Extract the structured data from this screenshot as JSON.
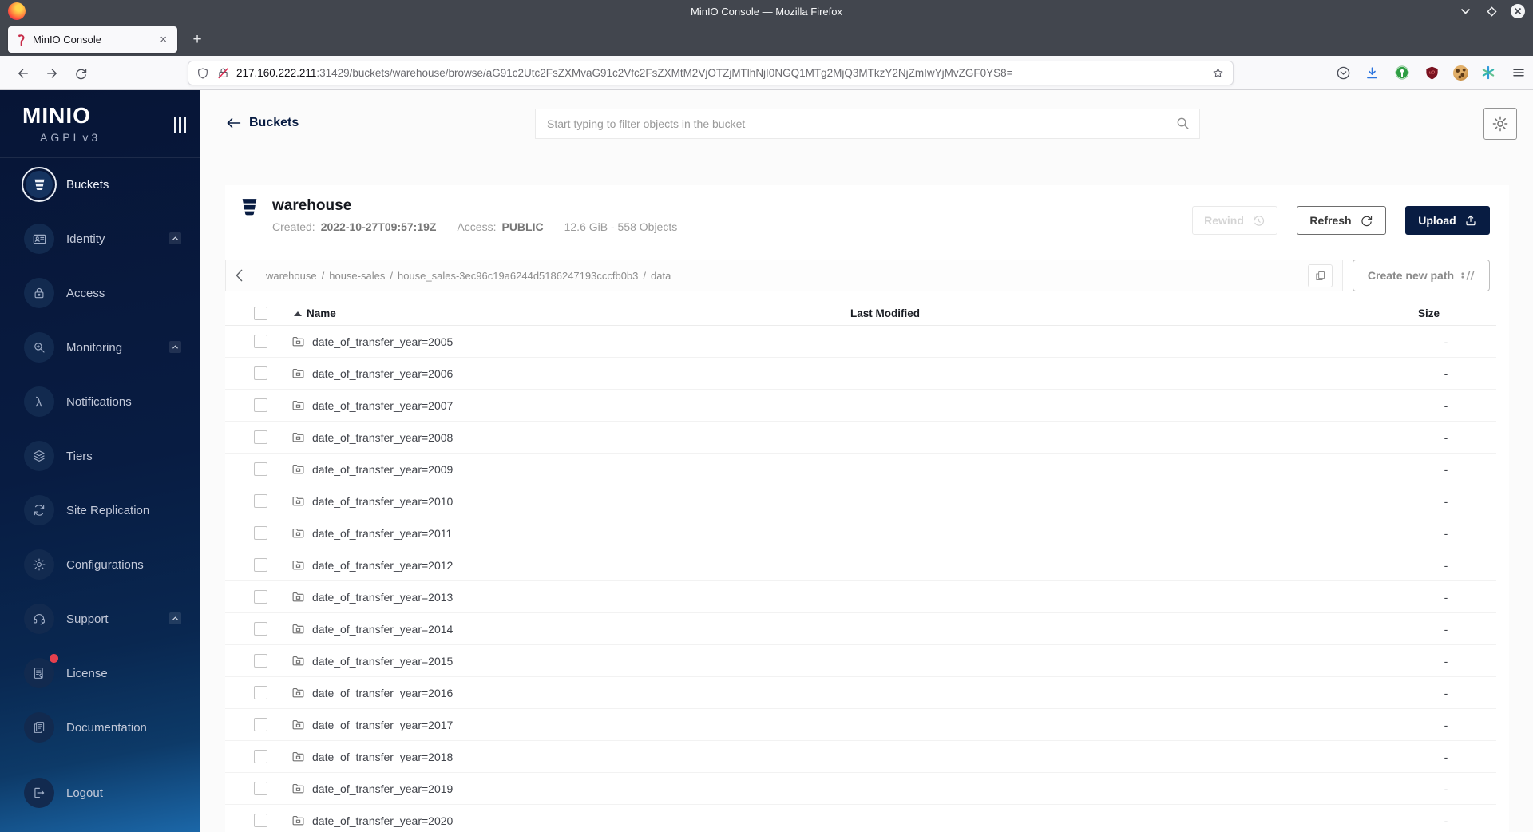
{
  "window": {
    "title": "MinIO Console — Mozilla Firefox"
  },
  "browser": {
    "tab_title": "MinIO Console",
    "tab_close_glyph": "×",
    "new_tab_glyph": "+",
    "url_domain": "217.160.222.211",
    "url_path": ":31429/buckets/warehouse/browse/aG91c2Utc2FsZXMvaG91c2Vfc2FsZXMtM2VjOTZjMTlhNjI0NGQ1MTg2MjQ3MTkzY2NjZmIwYjMvZGF0YS8="
  },
  "sidebar": {
    "logo": "MINIO",
    "edition": "AGPLv3",
    "items": [
      {
        "label": "Buckets"
      },
      {
        "label": "Identity"
      },
      {
        "label": "Access"
      },
      {
        "label": "Monitoring"
      },
      {
        "label": "Notifications"
      },
      {
        "label": "Tiers"
      },
      {
        "label": "Site Replication"
      },
      {
        "label": "Configurations"
      },
      {
        "label": "Support"
      },
      {
        "label": "License"
      },
      {
        "label": "Documentation"
      },
      {
        "label": "Logout"
      }
    ]
  },
  "header": {
    "back_label": "Buckets",
    "search_placeholder": "Start typing to filter objects in the bucket"
  },
  "bucket": {
    "name": "warehouse",
    "created_label": "Created:",
    "created_value": "2022-10-27T09:57:19Z",
    "access_label": "Access:",
    "access_value": "PUBLIC",
    "summary": "12.6 GiB - 558 Objects",
    "rewind_label": "Rewind",
    "refresh_label": "Refresh",
    "upload_label": "Upload"
  },
  "breadcrumb": {
    "separator": "/",
    "parts": [
      "warehouse",
      "house-sales",
      "house_sales-3ec96c19a6244d5186247193cccfb0b3",
      "data"
    ],
    "create_path_label": "Create new path"
  },
  "table": {
    "col_name": "Name",
    "col_modified": "Last Modified",
    "col_size": "Size",
    "rows": [
      {
        "name": "date_of_transfer_year=2005",
        "size": "-"
      },
      {
        "name": "date_of_transfer_year=2006",
        "size": "-"
      },
      {
        "name": "date_of_transfer_year=2007",
        "size": "-"
      },
      {
        "name": "date_of_transfer_year=2008",
        "size": "-"
      },
      {
        "name": "date_of_transfer_year=2009",
        "size": "-"
      },
      {
        "name": "date_of_transfer_year=2010",
        "size": "-"
      },
      {
        "name": "date_of_transfer_year=2011",
        "size": "-"
      },
      {
        "name": "date_of_transfer_year=2012",
        "size": "-"
      },
      {
        "name": "date_of_transfer_year=2013",
        "size": "-"
      },
      {
        "name": "date_of_transfer_year=2014",
        "size": "-"
      },
      {
        "name": "date_of_transfer_year=2015",
        "size": "-"
      },
      {
        "name": "date_of_transfer_year=2016",
        "size": "-"
      },
      {
        "name": "date_of_transfer_year=2017",
        "size": "-"
      },
      {
        "name": "date_of_transfer_year=2018",
        "size": "-"
      },
      {
        "name": "date_of_transfer_year=2019",
        "size": "-"
      },
      {
        "name": "date_of_transfer_year=2020",
        "size": "-"
      }
    ]
  }
}
